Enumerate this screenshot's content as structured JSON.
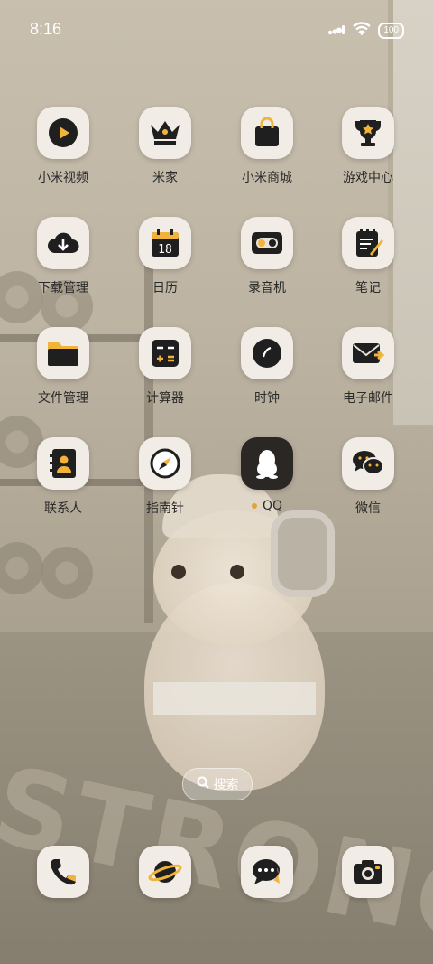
{
  "status_bar": {
    "time": "8:16",
    "battery": "100"
  },
  "apps": [
    {
      "label": "小米视频",
      "icon": "play-icon"
    },
    {
      "label": "米家",
      "icon": "crown-icon"
    },
    {
      "label": "小米商城",
      "icon": "shopping-bag-icon"
    },
    {
      "label": "游戏中心",
      "icon": "trophy-icon"
    },
    {
      "label": "下载管理",
      "icon": "cloud-download-icon"
    },
    {
      "label": "日历",
      "icon": "calendar-icon",
      "day": "18"
    },
    {
      "label": "录音机",
      "icon": "recorder-icon"
    },
    {
      "label": "笔记",
      "icon": "notepad-icon"
    },
    {
      "label": "文件管理",
      "icon": "folder-icon"
    },
    {
      "label": "计算器",
      "icon": "calculator-icon"
    },
    {
      "label": "时钟",
      "icon": "clock-icon"
    },
    {
      "label": "电子邮件",
      "icon": "mail-icon"
    },
    {
      "label": "联系人",
      "icon": "contacts-icon"
    },
    {
      "label": "指南针",
      "icon": "compass-icon"
    },
    {
      "label": "QQ",
      "icon": "qq-penguin-icon",
      "new_indicator": true
    },
    {
      "label": "微信",
      "icon": "wechat-icon"
    }
  ],
  "search": {
    "label": "搜索"
  },
  "dock": [
    {
      "icon": "phone-icon"
    },
    {
      "icon": "browser-planet-icon"
    },
    {
      "icon": "messages-icon"
    },
    {
      "icon": "camera-icon"
    }
  ],
  "wallpaper": {
    "floor_text": "STRONG"
  },
  "colors": {
    "accent": "#F2B33D",
    "icon_bg": "#F1EDE6",
    "glyph": "#1F1F1F"
  }
}
